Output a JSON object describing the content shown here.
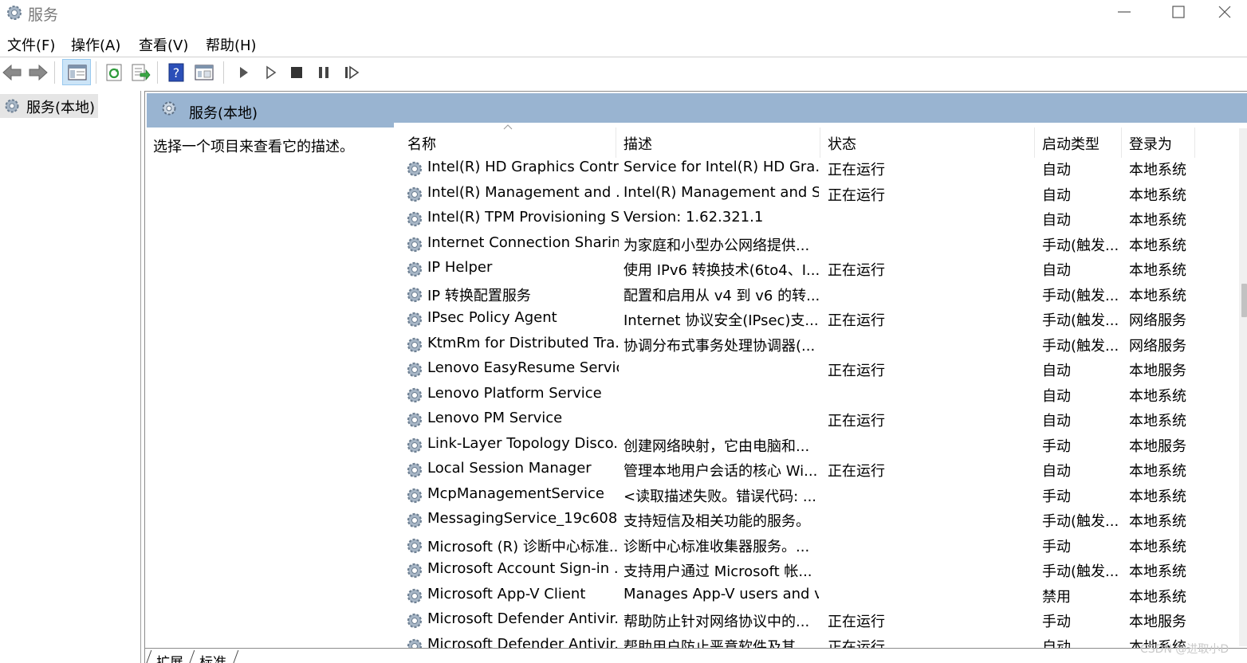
{
  "window": {
    "title": "服务"
  },
  "menu": [
    {
      "label": "文件(F)"
    },
    {
      "label": "操作(A)"
    },
    {
      "label": "查看(V)"
    },
    {
      "label": "帮助(H)"
    }
  ],
  "tree": {
    "root_label": "服务(本地)"
  },
  "panel": {
    "title": "服务(本地)",
    "description_hint": "选择一个项目来查看它的描述。"
  },
  "columns": {
    "name": "名称",
    "description": "描述",
    "status": "状态",
    "startup": "启动类型",
    "logon": "登录为"
  },
  "rows": [
    {
      "name": "Intel(R) HD Graphics Contr...",
      "description": "Service for Intel(R) HD Gra...",
      "status": "正在运行",
      "startup": "自动",
      "logon": "本地系统"
    },
    {
      "name": "Intel(R) Management and ...",
      "description": "Intel(R) Management and S...",
      "status": "正在运行",
      "startup": "自动",
      "logon": "本地系统"
    },
    {
      "name": "Intel(R) TPM Provisioning S...",
      "description": "Version: 1.62.321.1",
      "status": "",
      "startup": "自动",
      "logon": "本地系统"
    },
    {
      "name": "Internet Connection Sharin...",
      "description": "为家庭和小型办公网络提供...",
      "status": "",
      "startup": "手动(触发...",
      "logon": "本地系统"
    },
    {
      "name": "IP Helper",
      "description": "使用 IPv6 转换技术(6to4、I...",
      "status": "正在运行",
      "startup": "自动",
      "logon": "本地系统"
    },
    {
      "name": "IP 转换配置服务",
      "description": "配置和启用从 v4 到 v6 的转...",
      "status": "",
      "startup": "手动(触发...",
      "logon": "本地系统"
    },
    {
      "name": "IPsec Policy Agent",
      "description": "Internet 协议安全(IPsec)支...",
      "status": "正在运行",
      "startup": "手动(触发...",
      "logon": "网络服务"
    },
    {
      "name": "KtmRm for Distributed Tra...",
      "description": "协调分布式事务处理协调器(...",
      "status": "",
      "startup": "手动(触发...",
      "logon": "网络服务"
    },
    {
      "name": "Lenovo EasyResume Service",
      "description": "",
      "status": "正在运行",
      "startup": "自动",
      "logon": "本地服务"
    },
    {
      "name": "Lenovo Platform Service",
      "description": "",
      "status": "",
      "startup": "自动",
      "logon": "本地系统"
    },
    {
      "name": "Lenovo PM Service",
      "description": "",
      "status": "正在运行",
      "startup": "自动",
      "logon": "本地系统"
    },
    {
      "name": "Link-Layer Topology Disco...",
      "description": "创建网络映射，它由电脑和...",
      "status": "",
      "startup": "手动",
      "logon": "本地服务"
    },
    {
      "name": "Local Session Manager",
      "description": "管理本地用户会话的核心 Wi...",
      "status": "正在运行",
      "startup": "自动",
      "logon": "本地系统"
    },
    {
      "name": "McpManagementService",
      "description": "<读取描述失败。错误代码: ...",
      "status": "",
      "startup": "手动",
      "logon": "本地系统"
    },
    {
      "name": "MessagingService_19c608",
      "description": "支持短信及相关功能的服务。",
      "status": "",
      "startup": "手动(触发...",
      "logon": "本地系统"
    },
    {
      "name": "Microsoft (R) 诊断中心标准...",
      "description": "诊断中心标准收集器服务。...",
      "status": "",
      "startup": "手动",
      "logon": "本地系统"
    },
    {
      "name": "Microsoft Account Sign-in ...",
      "description": "支持用户通过 Microsoft 帐...",
      "status": "",
      "startup": "手动(触发...",
      "logon": "本地系统"
    },
    {
      "name": "Microsoft App-V Client",
      "description": "Manages App-V users and v...",
      "status": "",
      "startup": "禁用",
      "logon": "本地系统"
    },
    {
      "name": "Microsoft Defender Antivir...",
      "description": "帮助防止针对网络协议中的...",
      "status": "正在运行",
      "startup": "手动",
      "logon": "本地服务"
    },
    {
      "name": "Microsoft Defender Antivir...",
      "description": "帮助用户防止恶意软件及其...",
      "status": "正在运行",
      "startup": "自动",
      "logon": "本地系统"
    }
  ],
  "tabs": [
    {
      "label": "扩展"
    },
    {
      "label": "标准"
    }
  ],
  "watermark": "CSDN @进取小D"
}
